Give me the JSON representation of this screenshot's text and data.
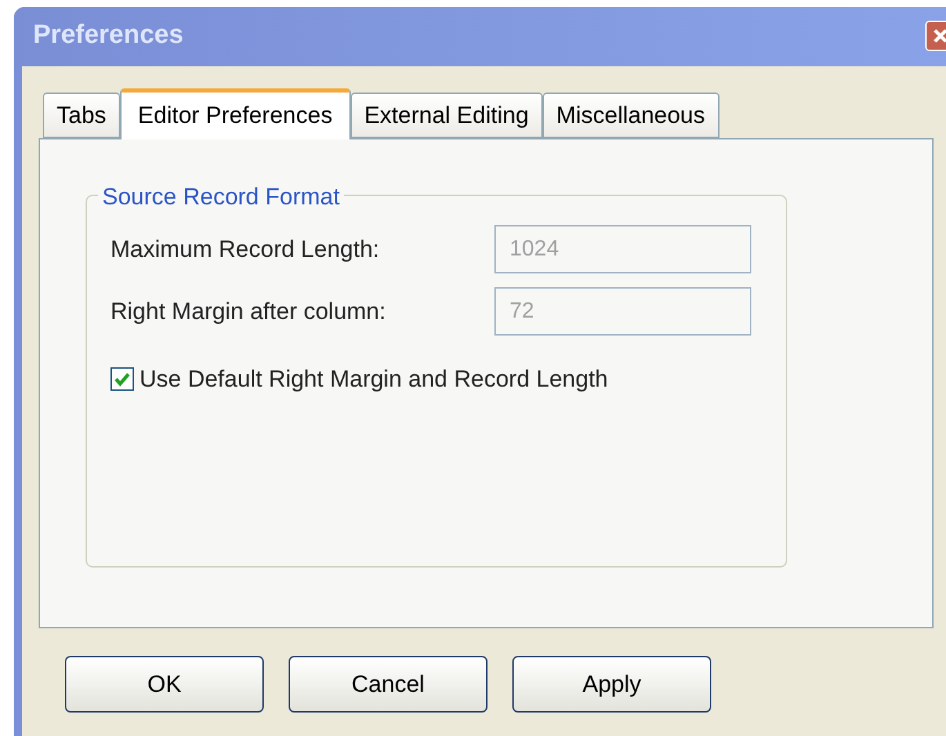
{
  "window": {
    "title": "Preferences"
  },
  "tabs": [
    {
      "label": "Tabs",
      "selected": false
    },
    {
      "label": "Editor Preferences",
      "selected": true
    },
    {
      "label": "External Editing",
      "selected": false
    },
    {
      "label": "Miscellaneous",
      "selected": false
    }
  ],
  "group": {
    "title": "Source Record Format",
    "fields": [
      {
        "label": "Maximum Record Length:",
        "value": "1024",
        "disabled": true
      },
      {
        "label": "Right Margin after column:",
        "value": "72",
        "disabled": true
      }
    ],
    "checkbox": {
      "label": "Use Default Right Margin and Record Length",
      "checked": true
    }
  },
  "buttons": [
    "OK",
    "Cancel",
    "Apply"
  ]
}
